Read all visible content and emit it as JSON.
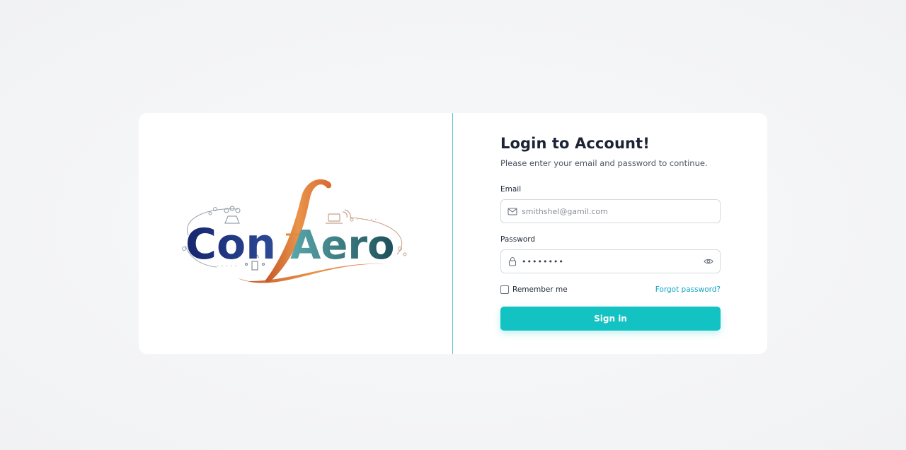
{
  "brand": {
    "name_part1": "Con",
    "name_f": "f",
    "name_part2": "Aero"
  },
  "login": {
    "title": "Login to Account!",
    "subtitle": "Please enter your email and password to continue.",
    "email_label": "Email",
    "email_placeholder": "smithshel@gamil.com",
    "password_label": "Password",
    "password_value": "••••••••",
    "remember_label": "Remember me",
    "forgot_label": "Forgot password?",
    "signin_label": "Sign in"
  },
  "icons": {
    "email": "mail-icon",
    "password": "lock-icon",
    "toggle": "eye-icon"
  },
  "colors": {
    "accent": "#13c2c2",
    "link": "#12a6c4",
    "brand_navy": "#1e2f7a",
    "brand_teal": "#6fb3b0",
    "brand_orange": "#e08a3c"
  }
}
